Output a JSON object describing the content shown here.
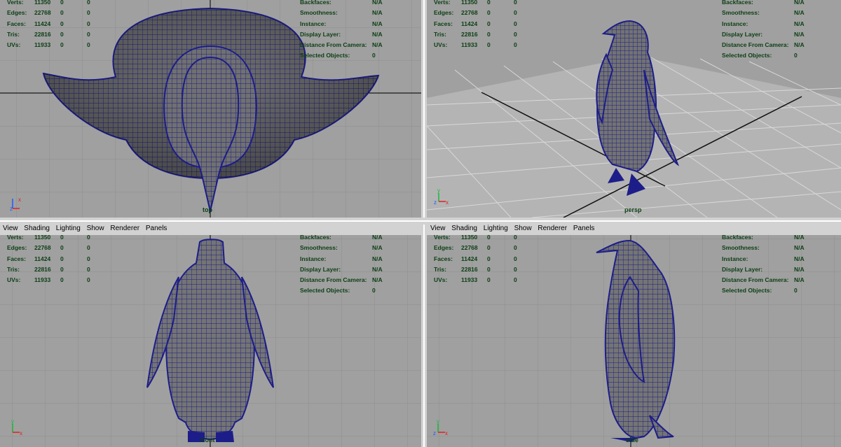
{
  "hud_stats": [
    {
      "label": "Verts:",
      "v1": "11350",
      "v2": "0",
      "v3": "0"
    },
    {
      "label": "Edges:",
      "v1": "22768",
      "v2": "0",
      "v3": "0"
    },
    {
      "label": "Faces:",
      "v1": "11424",
      "v2": "0",
      "v3": "0"
    },
    {
      "label": "Tris:",
      "v1": "22816",
      "v2": "0",
      "v3": "0"
    },
    {
      "label": "UVs:",
      "v1": "11933",
      "v2": "0",
      "v3": "0"
    }
  ],
  "hud_info": [
    {
      "label": "Backfaces:",
      "value": "N/A"
    },
    {
      "label": "Smoothness:",
      "value": "N/A"
    },
    {
      "label": "Instance:",
      "value": "N/A"
    },
    {
      "label": "Display Layer:",
      "value": "N/A"
    },
    {
      "label": "Distance From Camera:",
      "value": "N/A"
    },
    {
      "label": "Selected Objects:",
      "value": "0"
    }
  ],
  "panel_menu": [
    "View",
    "Shading",
    "Lighting",
    "Show",
    "Renderer",
    "Panels"
  ],
  "cameras": {
    "top": "top",
    "persp": "persp",
    "front": "front",
    "side": "side"
  },
  "axis_labels": {
    "x": "x",
    "y": "y",
    "z": "z"
  },
  "colors": {
    "viewport_bg": "#a0a0a0",
    "grid": "#8e8e8e",
    "axis_line": "#1a1a1a",
    "hud_text": "#0b3e14",
    "wire": "#1d1d8a",
    "mesh_fill": "#6e6e6e"
  }
}
